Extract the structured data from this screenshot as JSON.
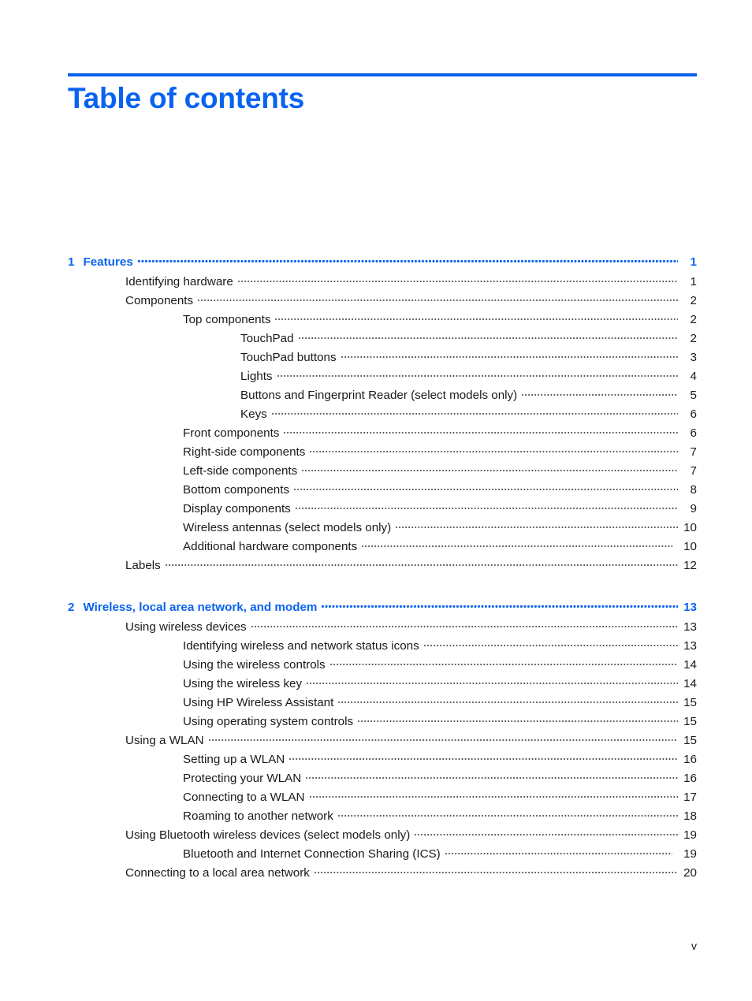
{
  "document": {
    "title": "Table of contents",
    "folio": "v",
    "accent_color": "#0a63ef",
    "text_color": "#1a1a1a"
  },
  "toc": {
    "chapters": [
      {
        "number": "1",
        "title": "Features",
        "page": "1",
        "entries": [
          {
            "level": 1,
            "label": "Identifying hardware",
            "page": "1"
          },
          {
            "level": 1,
            "label": "Components",
            "page": "2"
          },
          {
            "level": 2,
            "label": "Top components",
            "page": "2"
          },
          {
            "level": 3,
            "label": "TouchPad",
            "page": "2"
          },
          {
            "level": 3,
            "label": "TouchPad buttons",
            "page": "3"
          },
          {
            "level": 3,
            "label": "Lights",
            "page": "4"
          },
          {
            "level": 3,
            "label": "Buttons and Fingerprint Reader (select models only)",
            "page": "5"
          },
          {
            "level": 3,
            "label": "Keys",
            "page": "6"
          },
          {
            "level": 2,
            "label": "Front components",
            "page": "6"
          },
          {
            "level": 2,
            "label": "Right-side components",
            "page": "7"
          },
          {
            "level": 2,
            "label": "Left-side components",
            "page": "7"
          },
          {
            "level": 2,
            "label": "Bottom components",
            "page": "8"
          },
          {
            "level": 2,
            "label": "Display components",
            "page": "9"
          },
          {
            "level": 2,
            "label": "Wireless antennas (select models only)",
            "page": "10"
          },
          {
            "level": 2,
            "label": "Additional hardware components",
            "page": "10",
            "wide_gap": true
          },
          {
            "level": 1,
            "label": "Labels",
            "page": "12"
          }
        ]
      },
      {
        "number": "2",
        "title": "Wireless, local area network, and modem",
        "page": "13",
        "entries": [
          {
            "level": 1,
            "label": "Using wireless devices",
            "page": "13"
          },
          {
            "level": 2,
            "label": "Identifying wireless and network status icons",
            "page": "13"
          },
          {
            "level": 2,
            "label": "Using the wireless controls",
            "page": "14"
          },
          {
            "level": 2,
            "label": "Using the wireless key",
            "page": "14"
          },
          {
            "level": 2,
            "label": "Using HP Wireless Assistant",
            "page": "15"
          },
          {
            "level": 2,
            "label": "Using operating system controls",
            "page": "15"
          },
          {
            "level": 1,
            "label": "Using a WLAN",
            "page": "15"
          },
          {
            "level": 2,
            "label": "Setting up a WLAN",
            "page": "16"
          },
          {
            "level": 2,
            "label": "Protecting your WLAN",
            "page": "16"
          },
          {
            "level": 2,
            "label": "Connecting to a WLAN",
            "page": "17"
          },
          {
            "level": 2,
            "label": "Roaming to another network",
            "page": "18"
          },
          {
            "level": 1,
            "label": "Using Bluetooth wireless devices (select models only)",
            "page": "19"
          },
          {
            "level": 2,
            "label": "Bluetooth and Internet Connection Sharing (ICS)",
            "page": "19",
            "wide_gap": true
          },
          {
            "level": 1,
            "label": "Connecting to a local area network",
            "page": "20"
          }
        ]
      }
    ]
  }
}
